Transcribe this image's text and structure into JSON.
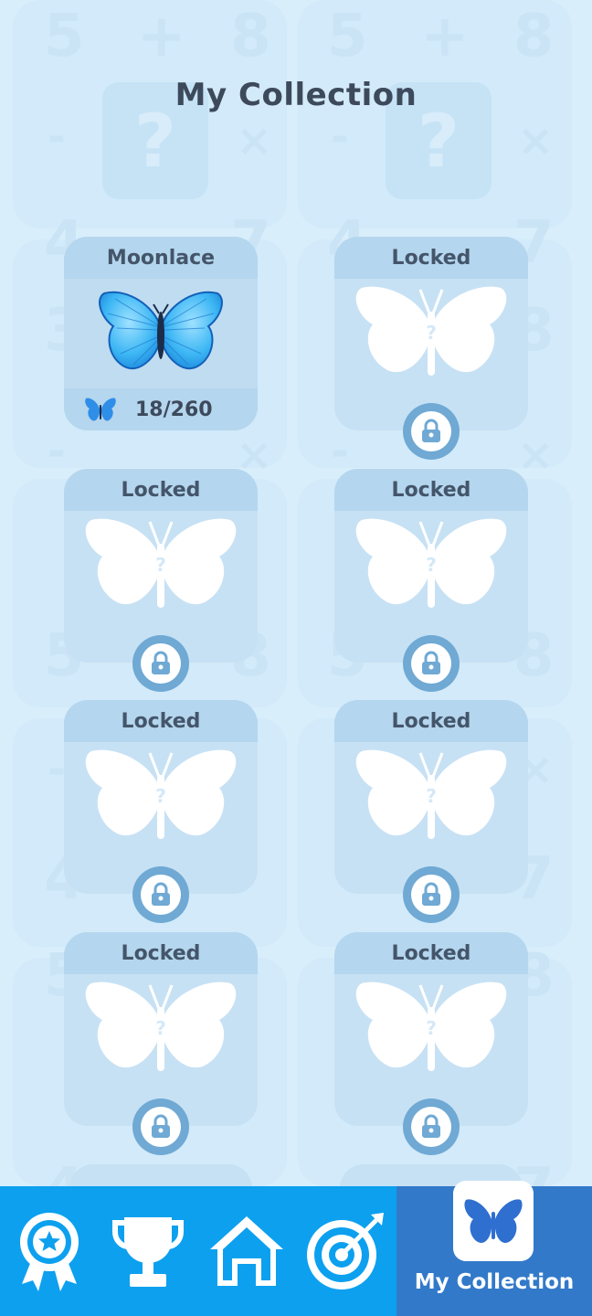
{
  "page": {
    "title": "My Collection"
  },
  "collection": [
    {
      "name": "Moonlace",
      "state": "unlocked",
      "count": "18/260"
    },
    {
      "name": "Locked",
      "state": "locked"
    },
    {
      "name": "Locked",
      "state": "locked"
    },
    {
      "name": "Locked",
      "state": "locked"
    },
    {
      "name": "Locked",
      "state": "locked"
    },
    {
      "name": "Locked",
      "state": "locked"
    },
    {
      "name": "Locked",
      "state": "locked"
    },
    {
      "name": "Locked",
      "state": "locked"
    }
  ],
  "nav": {
    "items": [
      {
        "icon": "award-badge-icon"
      },
      {
        "icon": "trophy-icon"
      },
      {
        "icon": "home-icon"
      },
      {
        "icon": "target-icon"
      },
      {
        "icon": "butterfly-icon",
        "label": "My Collection",
        "active": true
      }
    ]
  },
  "colors": {
    "background": "#d9eefb",
    "nav": "#0da0ef",
    "nav_active": "#3279c9",
    "card": "#c7e1f4",
    "lock": "#6fa9d4"
  }
}
